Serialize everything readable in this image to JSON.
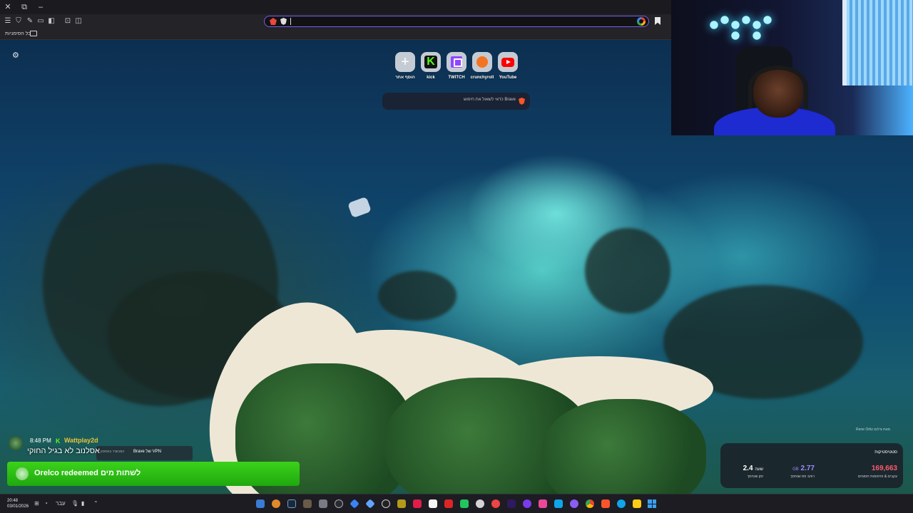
{
  "browser": {
    "bookmarks_bar": {
      "all_bookmarks": "כל הסימניות"
    },
    "top_sites": [
      {
        "label": "הוסף אתר",
        "icon": "plus-icon"
      },
      {
        "label": "kick",
        "icon": "kick-icon"
      },
      {
        "label": "TWITCH",
        "icon": "twitch-icon"
      },
      {
        "label": "crunchyroll",
        "icon": "crunchyroll-icon"
      },
      {
        "label": "YouTube",
        "icon": "youtube-icon"
      }
    ],
    "search": {
      "placeholder": "כדאי לשאול את חיפוש Brave"
    },
    "photo_credit": "Rene Ortiz מאת צילום",
    "stats": {
      "title": "סטטיסטיקות",
      "items": [
        {
          "value": "169,663",
          "caption": "עקבים & פרסומות חסומים",
          "color": "#ff5a6e"
        },
        {
          "value": "2.77",
          "unit": "GB",
          "caption": "רוחב פס שנחסך",
          "color": "#9b8cff"
        },
        {
          "value": "2.4",
          "unit": "שעה",
          "caption": "זמן שנחסך",
          "color": "#ffffff"
        }
      ]
    }
  },
  "overlay": {
    "chat": {
      "time": "8:48 PM",
      "username": "Wattplay2d",
      "message": "אסלנוב לא בגיל החוקי",
      "vpn_label": "Brave של VPN",
      "strip_hint": "המכשיר באחסון"
    },
    "redeem": {
      "text": "Orelco redeemed לשתות מים"
    }
  },
  "taskbar": {
    "time": "20:48",
    "date": "03/01/2026",
    "language": "עבר"
  },
  "colors": {
    "accent": "#7a5cf0",
    "kick_green": "#53fc18",
    "redeem_green": "#2dbf14"
  }
}
